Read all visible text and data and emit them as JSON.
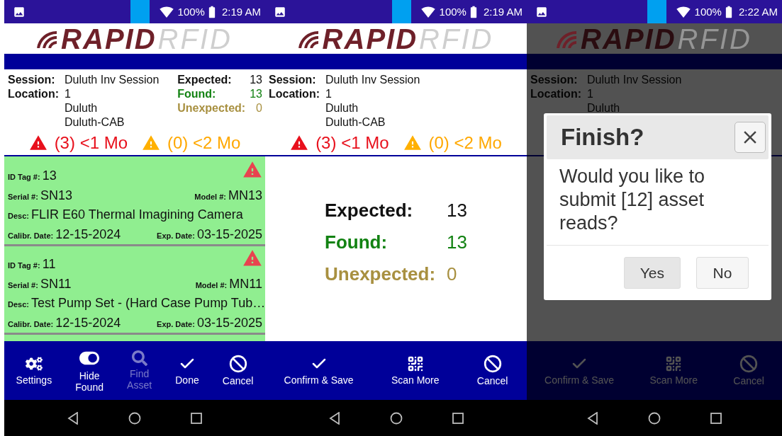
{
  "screens": [
    {
      "status_bar": {
        "battery": "100%",
        "time": "2:19 AM"
      },
      "logo": {
        "strong": "RAPID",
        "light": "RFID"
      },
      "header": {
        "session": {
          "label": "Session:",
          "value": "Duluth Inv Session"
        },
        "location": {
          "label": "Location:",
          "lines": [
            "1",
            "Duluth",
            "Duluth-CAB"
          ]
        },
        "counts": [
          {
            "label": "Expected:",
            "value": "13",
            "color": "#111111"
          },
          {
            "label": "Found:",
            "value": "13",
            "color": "#128212"
          },
          {
            "label": "Unexpected:",
            "value": "0",
            "color": "#a89040"
          }
        ]
      },
      "alerts": [
        {
          "text": "(3) <1 Mo",
          "color": "#e8101c"
        },
        {
          "text": "(0) <2 Mo",
          "color": "#ffa800"
        }
      ],
      "content": {
        "kind": "assets",
        "assets": [
          {
            "warning": true,
            "fields": [
              {
                "label": "ID Tag #:",
                "value": "13"
              },
              {
                "label": "Serial #:",
                "value": "SN13"
              },
              {
                "label": "Model #:",
                "value": "MN13"
              },
              {
                "label": "Desc:",
                "value": "FLIR E60 Thermal Imagining Camera"
              },
              {
                "label": "Calibr. Date:",
                "value": "12-15-2024"
              },
              {
                "label": "Exp. Date:",
                "value": "03-15-2025"
              }
            ]
          },
          {
            "warning": true,
            "fields": [
              {
                "label": "ID Tag #:",
                "value": "11"
              },
              {
                "label": "Serial #:",
                "value": "SN11"
              },
              {
                "label": "Model #:",
                "value": "MN11"
              },
              {
                "label": "Desc:",
                "value": "Test Pump Set - (Hard Case Pump Tub…"
              },
              {
                "label": "Calibr. Date:",
                "value": "12-15-2024"
              },
              {
                "label": "Exp. Date:",
                "value": "03-15-2025"
              }
            ]
          }
        ]
      },
      "toolbar": [
        {
          "kind": "settings",
          "label": "Settings",
          "disabled": false
        },
        {
          "kind": "toggle",
          "label": "Hide\nFound",
          "disabled": false,
          "on": true
        },
        {
          "kind": "search",
          "label": "Find\nAsset",
          "disabled": true
        },
        {
          "kind": "check",
          "label": "Done",
          "disabled": false
        },
        {
          "kind": "cancel",
          "label": "Cancel",
          "disabled": false
        }
      ]
    },
    {
      "status_bar": {
        "battery": "100%",
        "time": "2:19 AM"
      },
      "logo": {
        "strong": "RAPID",
        "light": "RFID"
      },
      "header": {
        "session": {
          "label": "Session:",
          "value": "Duluth Inv Session"
        },
        "location": {
          "label": "Location:",
          "lines": [
            "1",
            "Duluth",
            "Duluth-CAB"
          ]
        }
      },
      "alerts": [
        {
          "text": "(3) <1 Mo",
          "color": "#e8101c"
        },
        {
          "text": "(0) <2 Mo",
          "color": "#ffa800"
        }
      ],
      "content": {
        "kind": "summary",
        "counts": [
          {
            "label": "Expected:",
            "value": "13",
            "color": "#111111"
          },
          {
            "label": "Found:",
            "value": "13",
            "color": "#128212"
          },
          {
            "label": "Unexpected:",
            "value": "0",
            "color": "#a89040"
          }
        ]
      },
      "toolbar": [
        {
          "kind": "check",
          "label": "Confirm & Save",
          "disabled": false
        },
        {
          "kind": "qr",
          "label": "Scan More",
          "disabled": false
        },
        {
          "kind": "cancel",
          "label": "Cancel",
          "disabled": false
        }
      ]
    },
    {
      "status_bar": {
        "battery": "100%",
        "time": "2:22 AM"
      },
      "logo": {
        "strong": "RAPID",
        "light": "RFID"
      },
      "header": {
        "session": {
          "label": "Session:",
          "value": "Duluth Inv Session"
        },
        "location": {
          "label": "Location:",
          "lines": [
            "1",
            "Duluth"
          ]
        }
      },
      "content": {
        "kind": "empty"
      },
      "toolbar": [
        {
          "kind": "check",
          "label": "Confirm & Save",
          "disabled": false
        },
        {
          "kind": "qr",
          "label": "Scan More",
          "disabled": false
        },
        {
          "kind": "cancel",
          "label": "Cancel",
          "disabled": false
        }
      ],
      "dialog": {
        "title": "Finish?",
        "message": "Would you like to submit [12] asset reads?",
        "buttons": [
          {
            "label": "Yes",
            "selected": true
          },
          {
            "label": "No",
            "selected": false
          }
        ]
      }
    }
  ]
}
